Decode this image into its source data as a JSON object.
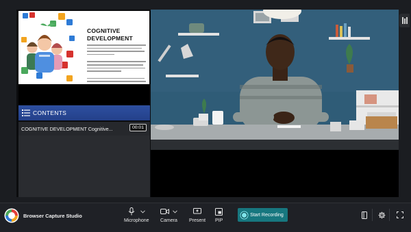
{
  "slide": {
    "title_line1": "COGNITIVE",
    "title_line2": "DEVELOPMENT"
  },
  "contents": {
    "label": "CONTENTS",
    "items": [
      {
        "title": "COGNITIVE DEVELOPMENT Cognitive...",
        "duration": "00:01"
      }
    ]
  },
  "toolbar": {
    "app_name": "Browser Capture Studio",
    "microphone_label": "Microphone",
    "camera_label": "Camera",
    "present_label": "Present",
    "pip_label": "PIP",
    "record_label": "Start Recording"
  },
  "colors": {
    "accent": "#17777f",
    "contents_bar": "#2d4fa0",
    "background": "#1b1d21"
  },
  "icons": [
    "list-icon",
    "microphone-icon",
    "camera-icon",
    "present-icon",
    "pip-icon",
    "record-icon",
    "panel-icon",
    "gear-icon",
    "fullscreen-icon",
    "handle-icon",
    "app-logo"
  ]
}
